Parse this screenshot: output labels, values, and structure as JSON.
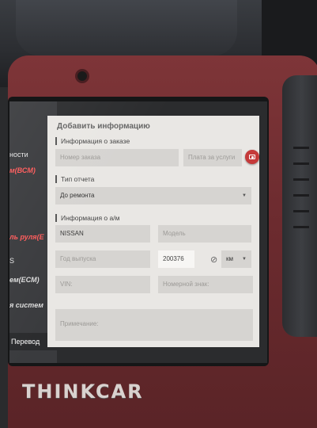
{
  "device": {
    "brand": "THINKCAR"
  },
  "background_app": {
    "rows": [
      {
        "text": "ности",
        "style": "plain"
      },
      {
        "text": "м(ВСМ)",
        "style": "red"
      },
      {
        "text": "ль руля(Е",
        "style": "red"
      },
      {
        "text": "S",
        "style": "plain"
      },
      {
        "text": "ем(ECM)",
        "style": "plain"
      },
      {
        "text": "я систем",
        "style": "plain"
      }
    ],
    "footer_label": "Перевод"
  },
  "dialog": {
    "title": "Добавить информацию",
    "order_section": {
      "label": "Информация о заказе",
      "order_number_placeholder": "Номер заказа",
      "service_fee_placeholder": "Плата за услуги"
    },
    "report_section": {
      "label": "Тип отчета",
      "selected": "До ремонта"
    },
    "vehicle_section": {
      "label": "Информация о а/м",
      "make_value": "NISSAN",
      "model_placeholder": "Модель",
      "year_placeholder": "Год выпуска",
      "mileage_value": "200376",
      "unit_value": "км",
      "vin_placeholder": "VIN:",
      "plate_placeholder": "Номерной знак:"
    },
    "note_placeholder": "Примечание:"
  },
  "icons": {
    "camera": "camera-icon",
    "link": "link-icon",
    "dropdown": "chevron-down-icon"
  },
  "colors": {
    "accent": "#c53a3a",
    "dialog_bg": "#e9e7e4",
    "field_bg": "#d6d4d1",
    "device_body": "#7e3538"
  }
}
